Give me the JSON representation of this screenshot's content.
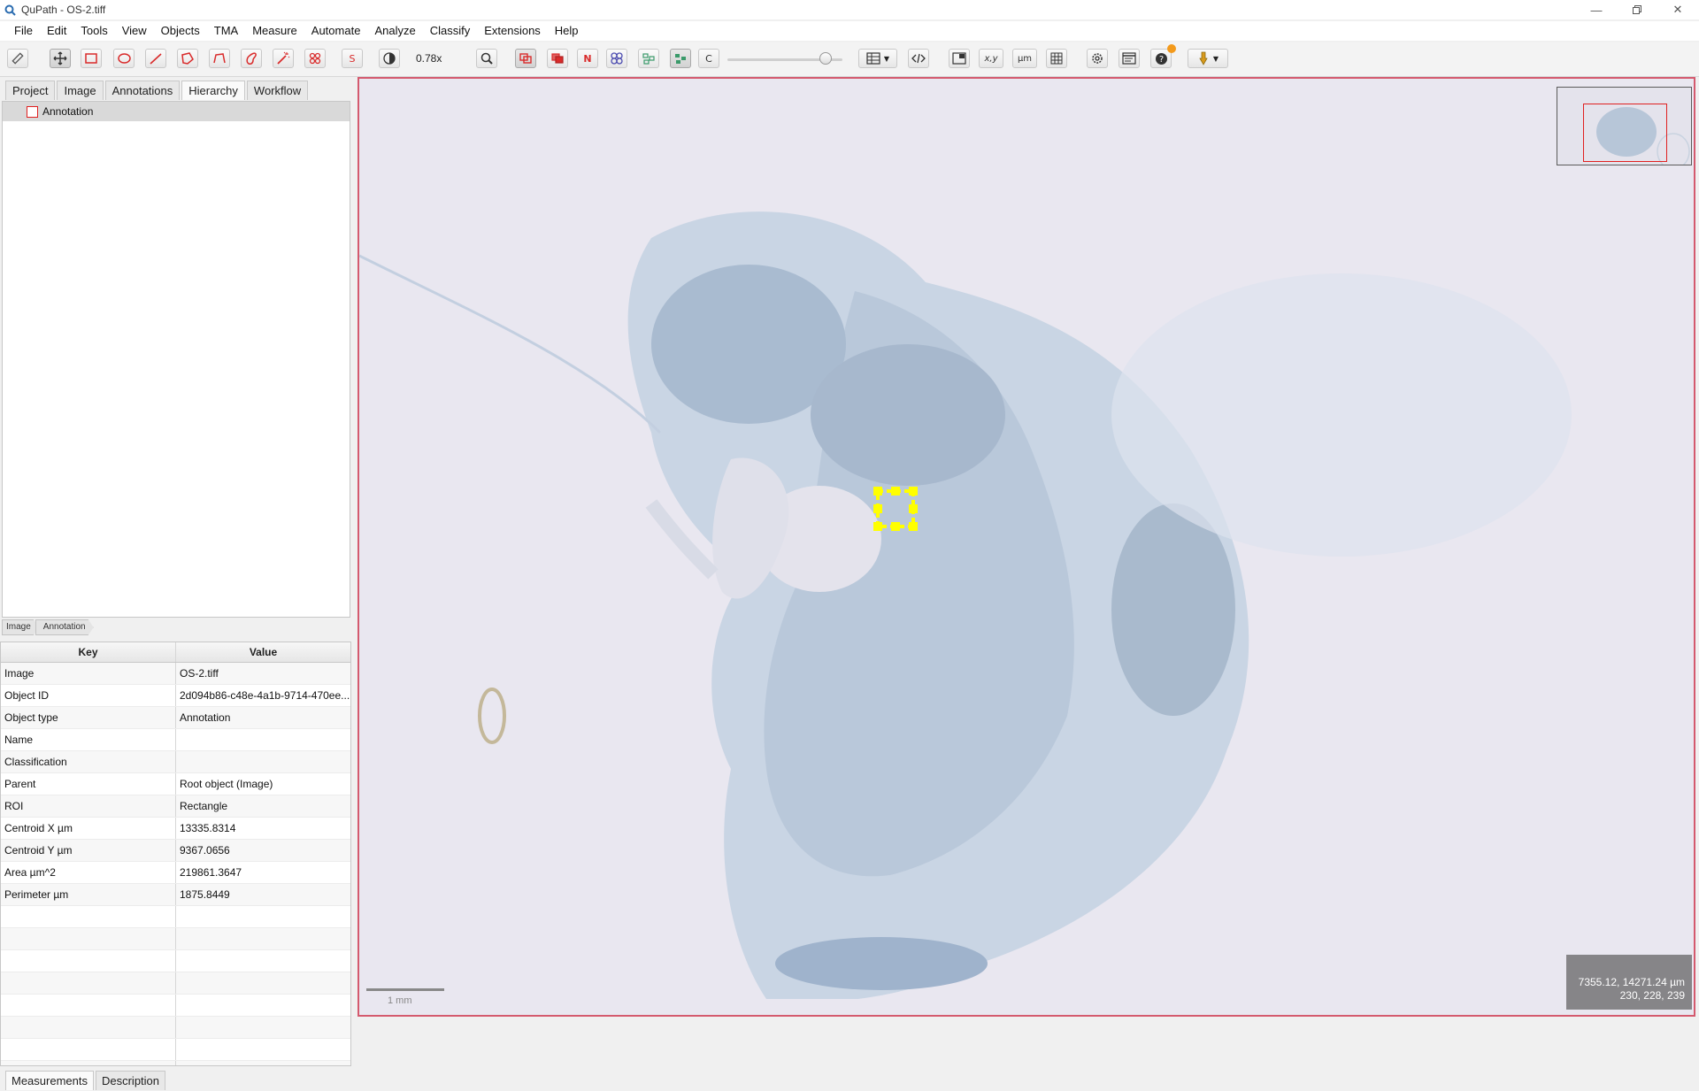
{
  "window": {
    "title": "QuPath - OS-2.tiff",
    "app_icon": "qupath-icon"
  },
  "menu": [
    "File",
    "Edit",
    "Tools",
    "View",
    "Objects",
    "TMA",
    "Measure",
    "Automate",
    "Analyze",
    "Classify",
    "Extensions",
    "Help"
  ],
  "toolbar": {
    "zoom": "0.78x",
    "spot_label": "S",
    "nuclei_label": "N",
    "counting_label": "C",
    "xy_label": "x,y",
    "um_label": "µm"
  },
  "left": {
    "tabs": [
      "Project",
      "Image",
      "Annotations",
      "Hierarchy",
      "Workflow"
    ],
    "selected_tab": "Hierarchy",
    "tree": [
      {
        "label": "Annotation",
        "color": "#e02020"
      }
    ],
    "breadcrumb": [
      "Image",
      "Annotation"
    ],
    "table": {
      "headers": [
        "Key",
        "Value"
      ],
      "rows": [
        [
          "Image",
          "OS-2.tiff"
        ],
        [
          "Object ID",
          "2d094b86-c48e-4a1b-9714-470ee..."
        ],
        [
          "Object type",
          "Annotation"
        ],
        [
          "Name",
          ""
        ],
        [
          "Classification",
          ""
        ],
        [
          "Parent",
          "Root object (Image)"
        ],
        [
          "ROI",
          "Rectangle"
        ],
        [
          "Centroid X µm",
          "13335.8314"
        ],
        [
          "Centroid Y µm",
          "9367.0656"
        ],
        [
          "Area µm^2",
          "219861.3647"
        ],
        [
          "Perimeter µm",
          "1875.8449"
        ]
      ]
    },
    "bottom_tabs": [
      "Measurements",
      "Description"
    ]
  },
  "viewer": {
    "scale_label": "1 mm",
    "cursor_coords": "7355.12, 14271.24 µm",
    "cursor_rgb": "230, 228, 239",
    "selection_color": "#ffff00",
    "frame_color": "#d45a6e"
  }
}
